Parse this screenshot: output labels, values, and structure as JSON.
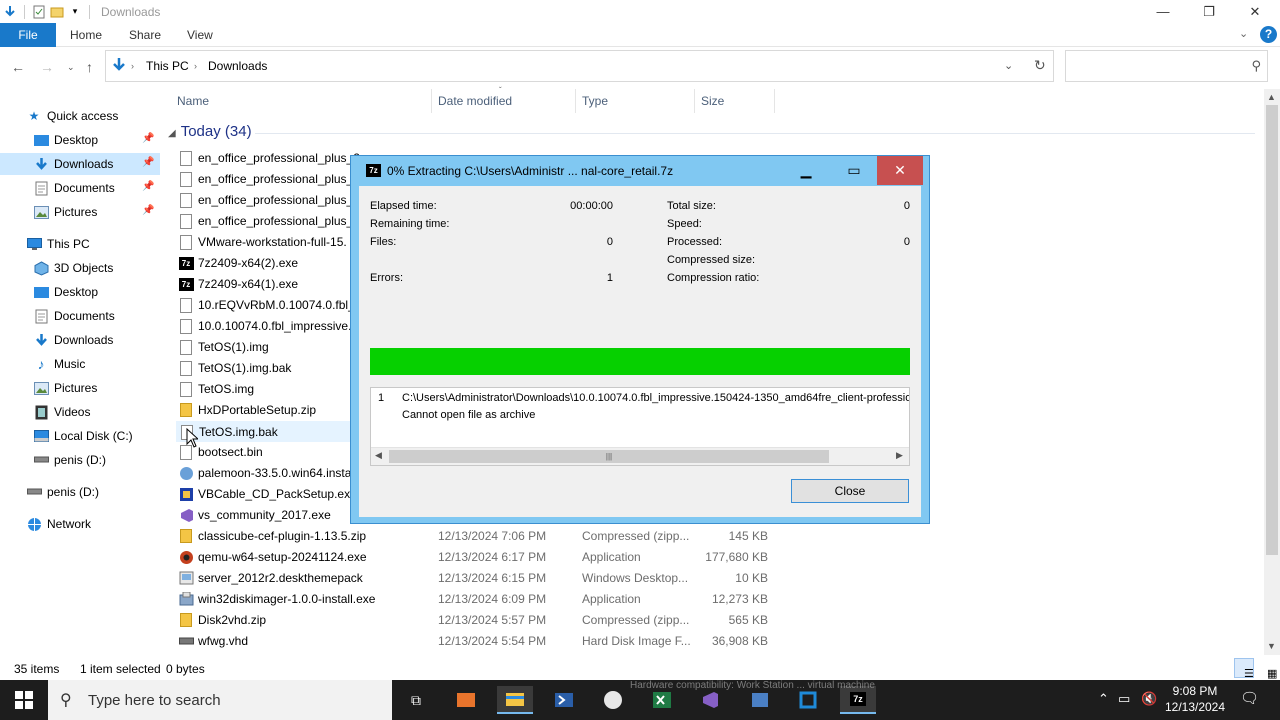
{
  "window": {
    "title": "Downloads",
    "controls": {
      "minimize": "—",
      "maximize": "❐",
      "close": "✕"
    }
  },
  "ribbon": {
    "tabs": [
      "File",
      "Home",
      "Share",
      "View"
    ],
    "help": "?"
  },
  "address": {
    "crumbs": [
      "This PC",
      "Downloads"
    ],
    "search_placeholder": ""
  },
  "sidebar": {
    "items": [
      {
        "label": "Quick access",
        "icon": "star-icon"
      },
      {
        "label": "Desktop",
        "icon": "desktop-folder-icon"
      },
      {
        "label": "Downloads",
        "icon": "download-folder-icon"
      },
      {
        "label": "Documents",
        "icon": "documents-folder-icon"
      },
      {
        "label": "Pictures",
        "icon": "pictures-folder-icon"
      },
      {
        "label": "This PC",
        "icon": "computer-icon"
      },
      {
        "label": "3D Objects",
        "icon": "3d-objects-icon"
      },
      {
        "label": "Desktop",
        "icon": "desktop-folder-icon"
      },
      {
        "label": "Documents",
        "icon": "documents-folder-icon"
      },
      {
        "label": "Downloads",
        "icon": "download-folder-icon"
      },
      {
        "label": "Music",
        "icon": "music-icon"
      },
      {
        "label": "Pictures",
        "icon": "pictures-folder-icon"
      },
      {
        "label": "Videos",
        "icon": "videos-icon"
      },
      {
        "label": "Local Disk (C:)",
        "icon": "drive-icon"
      },
      {
        "label": "penis (D:)",
        "icon": "removable-drive-icon"
      },
      {
        "label": "penis (D:)",
        "icon": "removable-drive-icon"
      },
      {
        "label": "Network",
        "icon": "network-icon"
      }
    ]
  },
  "columns": [
    "Name",
    "Date modified",
    "Type",
    "Size"
  ],
  "group": {
    "label": "Today (34)"
  },
  "files": [
    {
      "name": "en_office_professional_plus_2",
      "date": "",
      "type": "",
      "size": "",
      "icon": "file-icon"
    },
    {
      "name": "en_office_professional_plus_2",
      "date": "",
      "type": "",
      "size": "",
      "icon": "file-icon"
    },
    {
      "name": "en_office_professional_plus_2",
      "date": "",
      "type": "",
      "size": "",
      "icon": "file-icon"
    },
    {
      "name": "en_office_professional_plus_2",
      "date": "",
      "type": "",
      "size": "",
      "icon": "file-icon"
    },
    {
      "name": "VMware-workstation-full-15.",
      "date": "",
      "type": "",
      "size": "",
      "icon": "file-icon"
    },
    {
      "name": "7z2409-x64(2).exe",
      "date": "",
      "type": "",
      "size": "",
      "icon": "7z-icon"
    },
    {
      "name": "7z2409-x64(1).exe",
      "date": "",
      "type": "",
      "size": "",
      "icon": "7z-icon"
    },
    {
      "name": "10.rEQVvRbM.0.10074.0.fbl_in",
      "date": "",
      "type": "",
      "size": "",
      "icon": "file-icon"
    },
    {
      "name": "10.0.10074.0.fbl_impressive.15",
      "date": "",
      "type": "",
      "size": "",
      "icon": "file-icon"
    },
    {
      "name": "TetOS(1).img",
      "date": "",
      "type": "",
      "size": "",
      "icon": "disc-image-icon"
    },
    {
      "name": "TetOS(1).img.bak",
      "date": "",
      "type": "",
      "size": "",
      "icon": "file-icon"
    },
    {
      "name": "TetOS.img",
      "date": "",
      "type": "",
      "size": "",
      "icon": "disc-image-icon"
    },
    {
      "name": "HxDPortableSetup.zip",
      "date": "",
      "type": "",
      "size": "",
      "icon": "zip-icon"
    },
    {
      "name": "TetOS.img.bak",
      "date": "",
      "type": "",
      "size": "",
      "icon": "file-icon"
    },
    {
      "name": "bootsect.bin",
      "date": "",
      "type": "",
      "size": "",
      "icon": "file-icon"
    },
    {
      "name": "palemoon-33.5.0.win64.insta",
      "date": "",
      "type": "",
      "size": "",
      "icon": "palemoon-icon"
    },
    {
      "name": "VBCable_CD_PackSetup.exe",
      "date": "",
      "type": "",
      "size": "",
      "icon": "vbcable-icon"
    },
    {
      "name": "vs_community_2017.exe",
      "date": "",
      "type": "",
      "size": "",
      "icon": "visual-studio-icon"
    },
    {
      "name": "classicube-cef-plugin-1.13.5.zip",
      "date": "12/13/2024 7:06 PM",
      "type": "Compressed (zipp...",
      "size": "145 KB",
      "icon": "zip-icon"
    },
    {
      "name": "qemu-w64-setup-20241124.exe",
      "date": "12/13/2024 6:17 PM",
      "type": "Application",
      "size": "177,680 KB",
      "icon": "qemu-icon"
    },
    {
      "name": "server_2012r2.deskthemepack",
      "date": "12/13/2024 6:15 PM",
      "type": "Windows Desktop...",
      "size": "10 KB",
      "icon": "theme-pack-icon"
    },
    {
      "name": "win32diskimager-1.0.0-install.exe",
      "date": "12/13/2024 6:09 PM",
      "type": "Application",
      "size": "12,273 KB",
      "icon": "installer-icon"
    },
    {
      "name": "Disk2vhd.zip",
      "date": "12/13/2024 5:57 PM",
      "type": "Compressed (zipp...",
      "size": "565 KB",
      "icon": "zip-icon"
    },
    {
      "name": "wfwg.vhd",
      "date": "12/13/2024 5:54 PM",
      "type": "Hard Disk Image F...",
      "size": "36,908 KB",
      "icon": "vhd-icon"
    }
  ],
  "status": {
    "items": "35 items",
    "selected": "1 item selected",
    "size": "0 bytes"
  },
  "dialog": {
    "title": "0% Extracting C:\\Users\\Administr ... nal-core_retail.7z",
    "progress_percent": 100,
    "stats_left": [
      {
        "label": "Elapsed time:",
        "value": "00:00:00"
      },
      {
        "label": "Remaining time:",
        "value": ""
      },
      {
        "label": "Files:",
        "value": "0"
      },
      {
        "label": "Errors:",
        "value": "1"
      }
    ],
    "stats_right": [
      {
        "label": "Total size:",
        "value": "0"
      },
      {
        "label": "Speed:",
        "value": ""
      },
      {
        "label": "Processed:",
        "value": "0"
      },
      {
        "label": "Compressed size:",
        "value": ""
      },
      {
        "label": "Compression ratio:",
        "value": ""
      }
    ],
    "log": {
      "index": "1",
      "path": "C:\\Users\\Administrator\\Downloads\\10.0.10074.0.fbl_impressive.150424-1350_amd64fre_client-professiona",
      "message": "Cannot open file as archive"
    },
    "close_label": "Close",
    "colors": {
      "progress": "#06d000",
      "frame": "#80c8f2",
      "close_button": "#c75050"
    }
  },
  "taskbar": {
    "search_placeholder": "Type here to search",
    "time": "9:08 PM",
    "date": "12/13/2024",
    "ghost_notification": "Hardware compatibility: Work Station ... virtual machine"
  }
}
